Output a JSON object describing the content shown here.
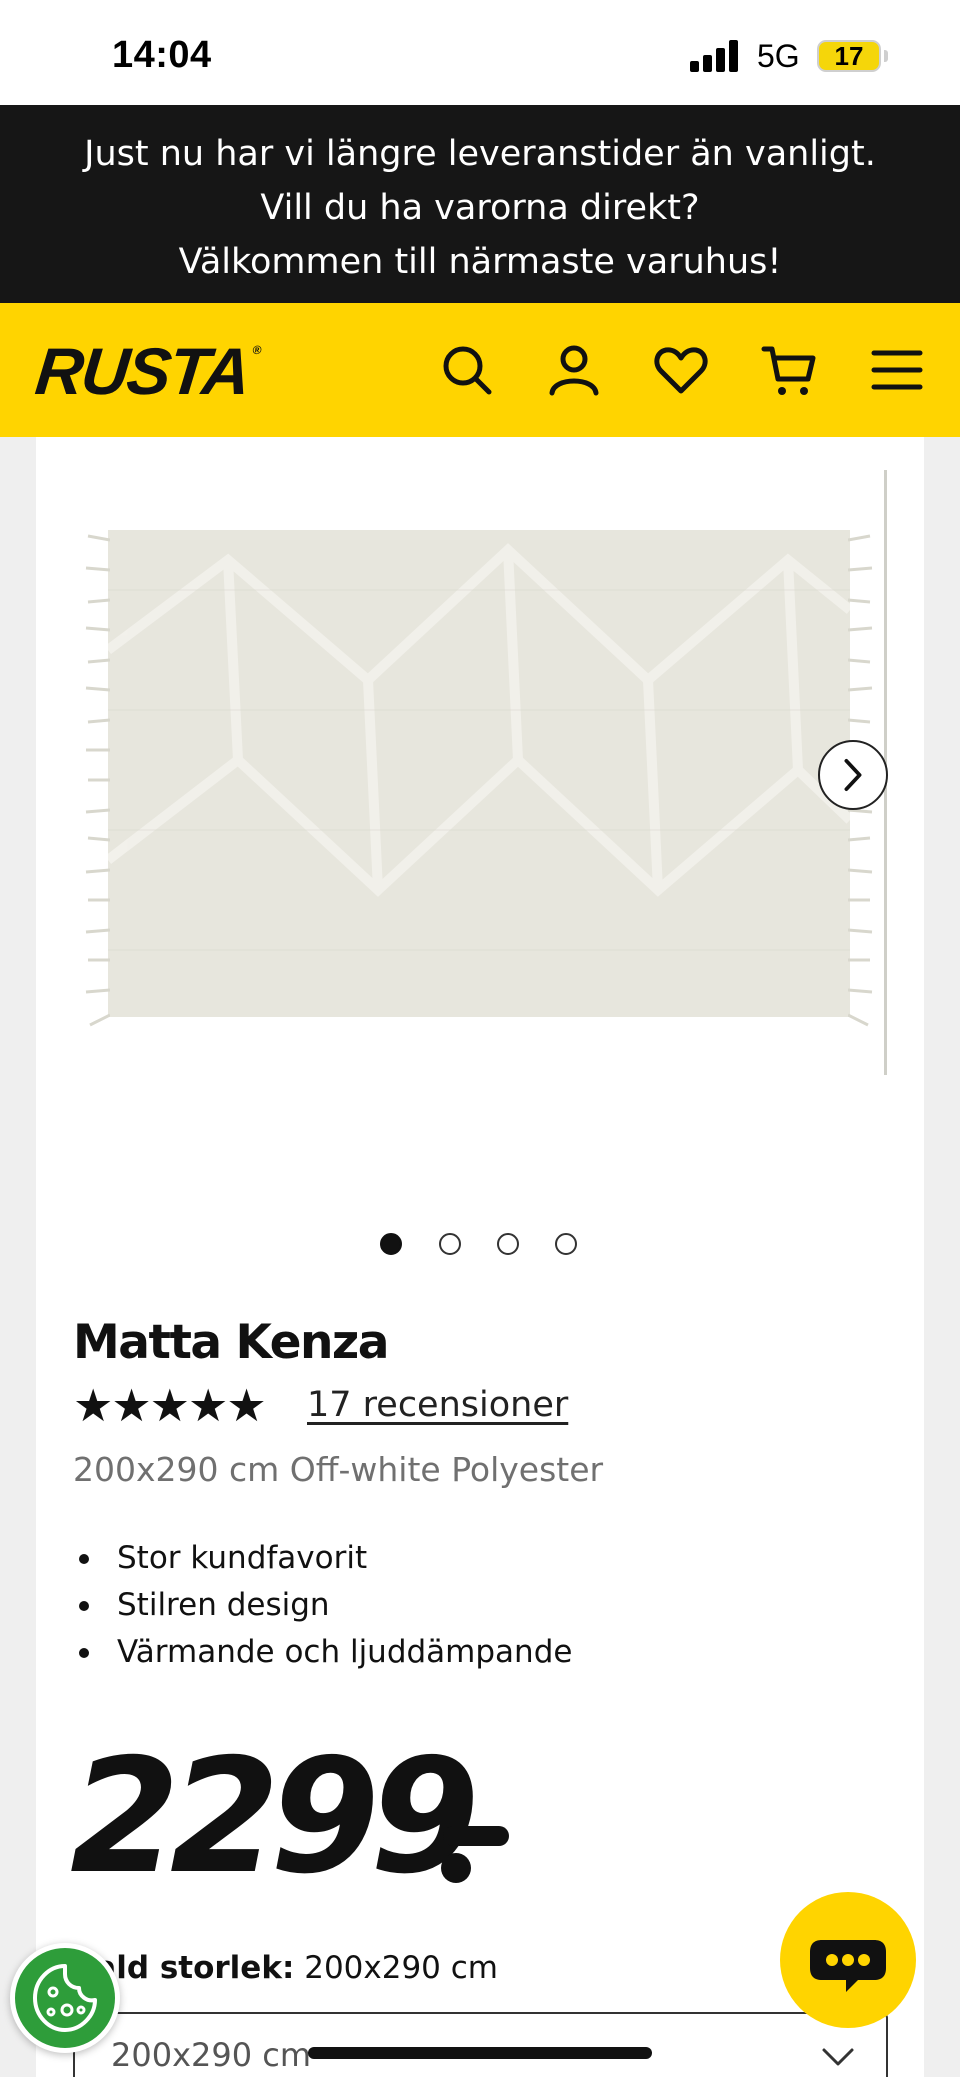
{
  "status_bar": {
    "time": "14:04",
    "network": "5G",
    "battery": "17"
  },
  "notice": {
    "lines": [
      "Just nu har vi längre leveranstider än vanligt.",
      "Vill du ha varorna direkt?",
      "Välkommen till närmaste varuhus!"
    ]
  },
  "header": {
    "logo": "RUSTA",
    "logo_mark": "®",
    "icons": [
      "search-icon",
      "account-icon",
      "heart-icon",
      "cart-icon",
      "menu-icon"
    ]
  },
  "gallery": {
    "image_count": 4,
    "active_index": 0
  },
  "product": {
    "title": "Matta Kenza",
    "rating": 5,
    "stars": "★★★★★",
    "reviews_label": "17 recensioner",
    "variant": "200x290 cm Off-white Polyester",
    "bullets": [
      "Stor kundfavorit",
      "Stilren design",
      "Värmande och ljuddämpande"
    ],
    "price": "2299"
  },
  "size": {
    "label": "Vald storlek:",
    "value": "200x290 cm",
    "selected": "200x290 cm"
  },
  "colors": {
    "brand_yellow": "#ffd400",
    "notice_bg": "#161616",
    "cookie_green": "#2e9d3a"
  }
}
